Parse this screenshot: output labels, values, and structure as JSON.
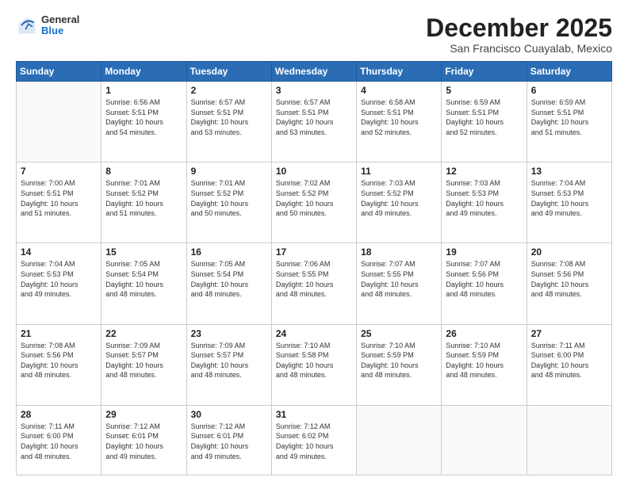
{
  "header": {
    "logo": {
      "general": "General",
      "blue": "Blue"
    },
    "title": "December 2025",
    "location": "San Francisco Cuayalab, Mexico"
  },
  "weekdays": [
    "Sunday",
    "Monday",
    "Tuesday",
    "Wednesday",
    "Thursday",
    "Friday",
    "Saturday"
  ],
  "weeks": [
    [
      {
        "day": "",
        "info": ""
      },
      {
        "day": "1",
        "info": "Sunrise: 6:56 AM\nSunset: 5:51 PM\nDaylight: 10 hours\nand 54 minutes."
      },
      {
        "day": "2",
        "info": "Sunrise: 6:57 AM\nSunset: 5:51 PM\nDaylight: 10 hours\nand 53 minutes."
      },
      {
        "day": "3",
        "info": "Sunrise: 6:57 AM\nSunset: 5:51 PM\nDaylight: 10 hours\nand 53 minutes."
      },
      {
        "day": "4",
        "info": "Sunrise: 6:58 AM\nSunset: 5:51 PM\nDaylight: 10 hours\nand 52 minutes."
      },
      {
        "day": "5",
        "info": "Sunrise: 6:59 AM\nSunset: 5:51 PM\nDaylight: 10 hours\nand 52 minutes."
      },
      {
        "day": "6",
        "info": "Sunrise: 6:59 AM\nSunset: 5:51 PM\nDaylight: 10 hours\nand 51 minutes."
      }
    ],
    [
      {
        "day": "7",
        "info": "Sunrise: 7:00 AM\nSunset: 5:51 PM\nDaylight: 10 hours\nand 51 minutes."
      },
      {
        "day": "8",
        "info": "Sunrise: 7:01 AM\nSunset: 5:52 PM\nDaylight: 10 hours\nand 51 minutes."
      },
      {
        "day": "9",
        "info": "Sunrise: 7:01 AM\nSunset: 5:52 PM\nDaylight: 10 hours\nand 50 minutes."
      },
      {
        "day": "10",
        "info": "Sunrise: 7:02 AM\nSunset: 5:52 PM\nDaylight: 10 hours\nand 50 minutes."
      },
      {
        "day": "11",
        "info": "Sunrise: 7:03 AM\nSunset: 5:52 PM\nDaylight: 10 hours\nand 49 minutes."
      },
      {
        "day": "12",
        "info": "Sunrise: 7:03 AM\nSunset: 5:53 PM\nDaylight: 10 hours\nand 49 minutes."
      },
      {
        "day": "13",
        "info": "Sunrise: 7:04 AM\nSunset: 5:53 PM\nDaylight: 10 hours\nand 49 minutes."
      }
    ],
    [
      {
        "day": "14",
        "info": "Sunrise: 7:04 AM\nSunset: 5:53 PM\nDaylight: 10 hours\nand 49 minutes."
      },
      {
        "day": "15",
        "info": "Sunrise: 7:05 AM\nSunset: 5:54 PM\nDaylight: 10 hours\nand 48 minutes."
      },
      {
        "day": "16",
        "info": "Sunrise: 7:05 AM\nSunset: 5:54 PM\nDaylight: 10 hours\nand 48 minutes."
      },
      {
        "day": "17",
        "info": "Sunrise: 7:06 AM\nSunset: 5:55 PM\nDaylight: 10 hours\nand 48 minutes."
      },
      {
        "day": "18",
        "info": "Sunrise: 7:07 AM\nSunset: 5:55 PM\nDaylight: 10 hours\nand 48 minutes."
      },
      {
        "day": "19",
        "info": "Sunrise: 7:07 AM\nSunset: 5:56 PM\nDaylight: 10 hours\nand 48 minutes."
      },
      {
        "day": "20",
        "info": "Sunrise: 7:08 AM\nSunset: 5:56 PM\nDaylight: 10 hours\nand 48 minutes."
      }
    ],
    [
      {
        "day": "21",
        "info": "Sunrise: 7:08 AM\nSunset: 5:56 PM\nDaylight: 10 hours\nand 48 minutes."
      },
      {
        "day": "22",
        "info": "Sunrise: 7:09 AM\nSunset: 5:57 PM\nDaylight: 10 hours\nand 48 minutes."
      },
      {
        "day": "23",
        "info": "Sunrise: 7:09 AM\nSunset: 5:57 PM\nDaylight: 10 hours\nand 48 minutes."
      },
      {
        "day": "24",
        "info": "Sunrise: 7:10 AM\nSunset: 5:58 PM\nDaylight: 10 hours\nand 48 minutes."
      },
      {
        "day": "25",
        "info": "Sunrise: 7:10 AM\nSunset: 5:59 PM\nDaylight: 10 hours\nand 48 minutes."
      },
      {
        "day": "26",
        "info": "Sunrise: 7:10 AM\nSunset: 5:59 PM\nDaylight: 10 hours\nand 48 minutes."
      },
      {
        "day": "27",
        "info": "Sunrise: 7:11 AM\nSunset: 6:00 PM\nDaylight: 10 hours\nand 48 minutes."
      }
    ],
    [
      {
        "day": "28",
        "info": "Sunrise: 7:11 AM\nSunset: 6:00 PM\nDaylight: 10 hours\nand 48 minutes."
      },
      {
        "day": "29",
        "info": "Sunrise: 7:12 AM\nSunset: 6:01 PM\nDaylight: 10 hours\nand 49 minutes."
      },
      {
        "day": "30",
        "info": "Sunrise: 7:12 AM\nSunset: 6:01 PM\nDaylight: 10 hours\nand 49 minutes."
      },
      {
        "day": "31",
        "info": "Sunrise: 7:12 AM\nSunset: 6:02 PM\nDaylight: 10 hours\nand 49 minutes."
      },
      {
        "day": "",
        "info": ""
      },
      {
        "day": "",
        "info": ""
      },
      {
        "day": "",
        "info": ""
      }
    ]
  ]
}
